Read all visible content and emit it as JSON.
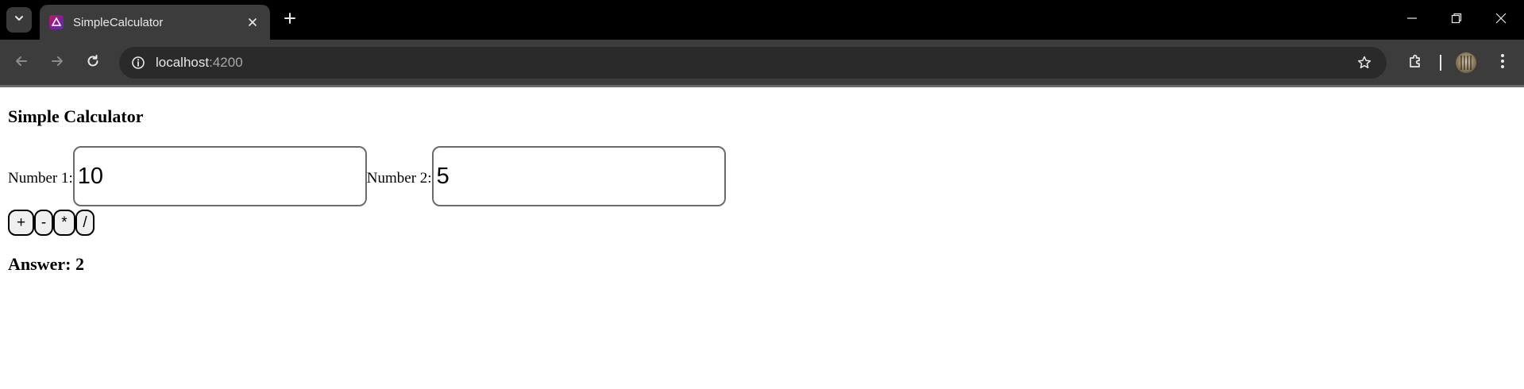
{
  "browser": {
    "tab": {
      "title": "SimpleCalculator"
    },
    "address_bar": {
      "host": "localhost",
      "port": ":4200"
    }
  },
  "app": {
    "title": "Simple Calculator",
    "fields": [
      {
        "label": "Number 1:",
        "value": "10"
      },
      {
        "label": "Number 2:",
        "value": "5"
      }
    ],
    "operations": [
      "+",
      "-",
      "*",
      "/"
    ],
    "answer_label": "Answer:",
    "answer_value": "2"
  },
  "colors": {
    "chrome_bg": "#000000",
    "toolbar_bg": "#3c3c3c",
    "omnibox_bg": "#2a2a2a",
    "page_bg": "#ffffff"
  }
}
